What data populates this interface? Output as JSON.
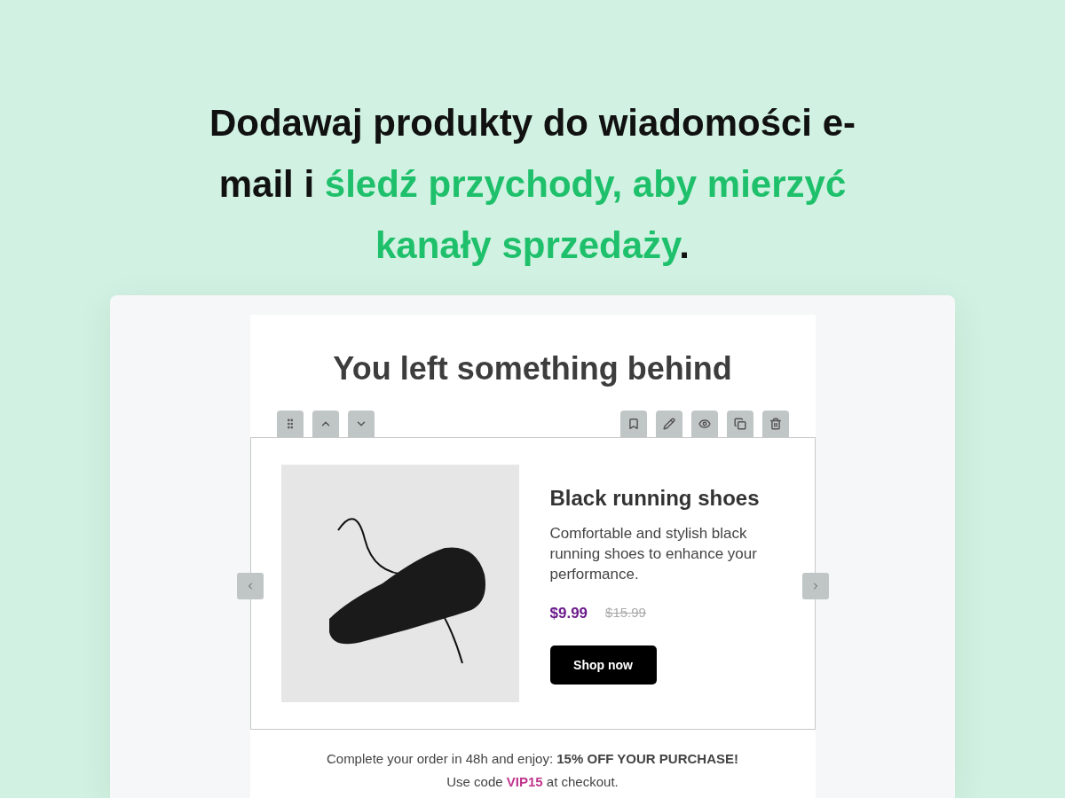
{
  "headline": [
    {
      "text": "Dodawaj produkty do wiadomości e-mail i ",
      "highlight": false
    },
    {
      "text": "śledź przychody, aby mierzyć kanały sprzedaży",
      "highlight": true
    },
    {
      "text": ".",
      "highlight": false
    }
  ],
  "email": {
    "title": "You left something behind",
    "product": {
      "name": "Black running shoes",
      "description": "Comfortable and stylish black running shoes to enhance your performance.",
      "price": "$9.99",
      "old_price": "$15.99",
      "button": "Shop now"
    },
    "footer": [
      [
        {
          "text": "Complete your order in 48h and enjoy: ",
          "kind": "text"
        },
        {
          "text": "15% OFF YOUR PURCHASE!",
          "kind": "offer"
        }
      ],
      [
        {
          "text": "Use code ",
          "kind": "text"
        },
        {
          "text": "VIP15",
          "kind": "code"
        },
        {
          "text": " at checkout.",
          "kind": "text"
        }
      ]
    ]
  }
}
